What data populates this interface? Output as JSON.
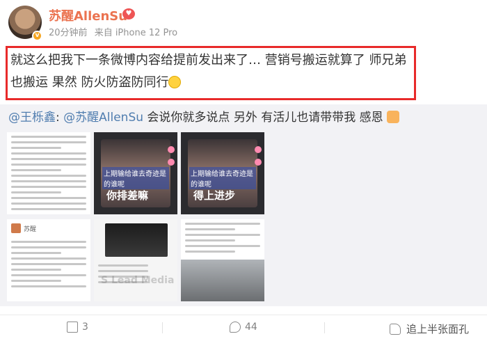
{
  "header": {
    "username": "苏醒AllenSu",
    "time": "20分钟前",
    "source": "来自 iPhone 12 Pro"
  },
  "post": {
    "text": "就这么把我下一条微博内容给提前发出来了… 营销号搬运就算了 师兄弟也搬运 果然 防火防盗防同行"
  },
  "repost": {
    "mention1": "@王栎鑫",
    "sep": ":",
    "mention2": "@苏醒AllenSu",
    "text": " 会说你就多说点 另外 有活儿也请带带我 感恩"
  },
  "images": {
    "video_caption_1": "上期输给谁去奇迹是的谁呢",
    "video_title_1": "你排差嘛",
    "video_caption_2": "上期输给谁去奇迹是的谁呢",
    "video_title_2": "得上进步",
    "doc_name": "苏醒",
    "watermark": "S Lead Media"
  },
  "footer": {
    "repost_count": "3",
    "comment_count": "44",
    "brand": "追上半张面孔"
  },
  "colors": {
    "highlight_border": "#e82a2a",
    "username": "#eb7350",
    "mention": "#507daf"
  }
}
